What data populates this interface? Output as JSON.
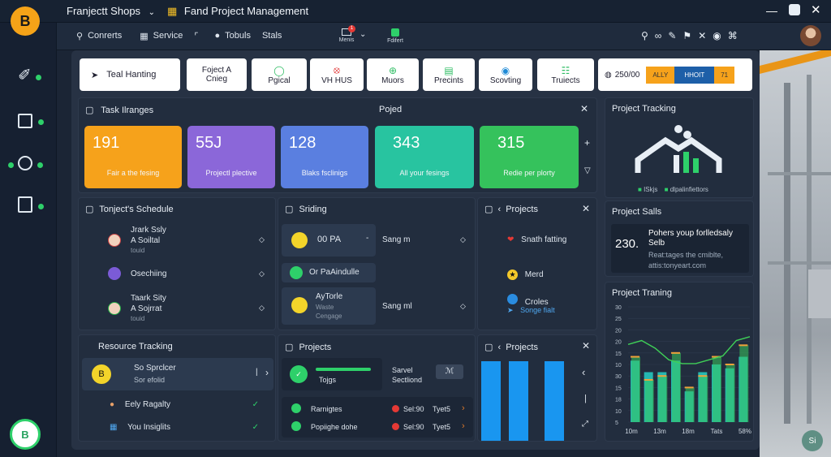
{
  "colors": {
    "accent": "#f6a21b",
    "green": "#2ed06a",
    "blue": "#1996f0"
  },
  "topbar": {
    "app_name": "Franjectt Shops",
    "module_title": "Fand Project Management"
  },
  "nav": {
    "items": [
      "Conrerts",
      "Service",
      "Tobuls",
      "Stals"
    ],
    "button_a": "Menis",
    "button_b": "Fdifert",
    "badge": "1"
  },
  "chips": {
    "first": "Teal Hanting",
    "items": [
      {
        "line1": "Foject A",
        "line2": "Cnieg"
      },
      {
        "line1": "",
        "line2": "Pgical"
      },
      {
        "line1": "",
        "line2": "VH HUS"
      },
      {
        "line1": "",
        "line2": "Muors"
      },
      {
        "line1": "",
        "line2": "Precints"
      },
      {
        "line1": "",
        "line2": "Scovting"
      },
      {
        "line1": "",
        "line2": "Truiects"
      }
    ],
    "progress_label": "250/00",
    "progress_segments": [
      "ALLY",
      "HHOIT",
      "71"
    ]
  },
  "task_ranges": {
    "title": "Task Ilranges",
    "second_title": "Pojed",
    "cards": [
      {
        "value": "191",
        "label": "Fair a the fesing"
      },
      {
        "value": "55J",
        "label": "Projectl plective"
      },
      {
        "value": "128",
        "label": "Blaks fsclinigs"
      },
      {
        "value": "343",
        "label": "All your fesings"
      },
      {
        "value": "315",
        "label": "Redie per plorty"
      }
    ]
  },
  "project_tracking": {
    "title": "Project Tracking",
    "legend_a": "ISkjs",
    "legend_b": "dlpalinfiettors"
  },
  "project_sales": {
    "title": "Project Salls",
    "value": "230.",
    "line1": "Pohers youp forlledsaly",
    "line2": "Selb",
    "line3": "Reat:tages the cmiblte,",
    "line4": "attis:tonyeart.com"
  },
  "schedule": {
    "title": "Tonject's Schedule",
    "rows": [
      {
        "l1": "Jrark Ssly",
        "l2": "A Soiltal",
        "l3": "touid"
      },
      {
        "l1": "Osechiing",
        "l2": "",
        "l3": ""
      },
      {
        "l1": "Taark Sity",
        "l2": "A Sojrrat",
        "l3": "touid"
      }
    ]
  },
  "sriding": {
    "title": "Sriding",
    "row1_left": "00 PA",
    "row1_right": "Sang m",
    "row2": "Or PaAindulle",
    "row3_l1": "AyTorle",
    "row3_l2": "Waste",
    "row3_l3": "Cengage",
    "row3_right": "Sang ml"
  },
  "projects_top": {
    "title": "Projects",
    "rows": [
      "Snath fatting",
      "Merd",
      "Croles",
      "Songe fialt"
    ]
  },
  "project_training": {
    "title": "Project Traning",
    "y_ticks": [
      "30",
      "25",
      "20",
      "20",
      "15",
      "10",
      "30",
      "15",
      "18",
      "10",
      "5"
    ],
    "x_ticks": [
      "10m",
      "13m",
      "18m",
      "Tats",
      "58%"
    ]
  },
  "chart_data": {
    "type": "bar",
    "categories": [
      "10m",
      "",
      "13m",
      "",
      "18m",
      "",
      "Tats",
      "",
      "58%"
    ],
    "series": [
      {
        "values": [
          16,
          13,
          13,
          16,
          8,
          13,
          15,
          14,
          17
        ]
      },
      {
        "values": [
          17,
          11,
          12,
          18,
          9,
          12,
          17,
          15,
          20
        ]
      }
    ],
    "line_values": [
      16,
      17,
      15,
      12,
      11,
      11,
      12,
      13,
      17,
      18
    ],
    "ylim": [
      0,
      30
    ],
    "grid": true
  },
  "resource": {
    "title": "Resource Tracking",
    "row1_l1": "So Sprclcer",
    "row1_l2": "Sor efolid",
    "row2": "Eely Ragalty",
    "row3": "You Insiglits"
  },
  "projects_mid": {
    "title": "Projects",
    "row1_left": "Tojgs",
    "row1_right_a": "Sarvel",
    "row1_right_b": "Sectliond",
    "row2_a": "Rarnigtes",
    "row2_b": "Popiighe dohe",
    "row2_c": "Sel:90",
    "row2_d": "Tyet5",
    "row2_e": "Sel:90",
    "row2_f": "Tyet5"
  },
  "projects_bottom": {
    "title": "Projects"
  },
  "avatar_bottom": "B",
  "logo_letter": "B",
  "corner_label": "Si"
}
